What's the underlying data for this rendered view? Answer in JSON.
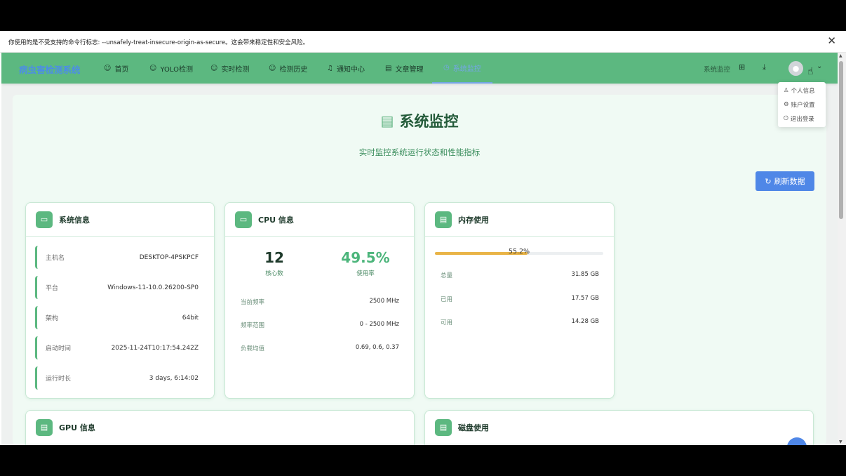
{
  "browser": {
    "warning": "你使用的是不受支持的命令行标志: --unsafely-treat-insecure-origin-as-secure。这会带来稳定性和安全风险。",
    "close_icon": "close-icon"
  },
  "nav": {
    "brand": "病虫害检测系统",
    "items": [
      {
        "label": "首页",
        "icon": "robot-icon"
      },
      {
        "label": "YOLO检测",
        "icon": "robot-icon"
      },
      {
        "label": "实时检测",
        "icon": "robot-icon"
      },
      {
        "label": "检测历史",
        "icon": "robot-icon"
      },
      {
        "label": "通知中心",
        "icon": "bell-icon"
      },
      {
        "label": "文章管理",
        "icon": "document-icon"
      },
      {
        "label": "系统监控",
        "icon": "monitor-icon"
      }
    ],
    "right_label": "系统监控",
    "user_menu": [
      "个人信息",
      "账户设置",
      "退出登录"
    ]
  },
  "page": {
    "title": "系统监控",
    "subtitle": "实时监控系统运行状态和性能指标",
    "refresh_label": "刷新数据"
  },
  "system_info": {
    "title": "系统信息",
    "rows": [
      {
        "key": "主机名",
        "value": "DESKTOP-4PSKPCF"
      },
      {
        "key": "平台",
        "value": "Windows-11-10.0.26200-SP0"
      },
      {
        "key": "架构",
        "value": "64bit"
      },
      {
        "key": "启动时间",
        "value": "2025-11-24T10:17:54.242Z"
      },
      {
        "key": "运行时长",
        "value": "3 days, 6:14:02"
      }
    ]
  },
  "cpu_info": {
    "title": "CPU 信息",
    "cores_value": "12",
    "cores_label": "核心数",
    "usage_value": "49.5%",
    "usage_label": "使用率",
    "rows": [
      {
        "key": "当前频率",
        "value": "2500 MHz"
      },
      {
        "key": "频率范围",
        "value": "0 - 2500 MHz"
      },
      {
        "key": "负载均值",
        "value": "0.69, 0.6, 0.37"
      }
    ]
  },
  "memory": {
    "title": "内存使用",
    "percent_label": "55.2%",
    "percent": 55.2,
    "bar_color": "#e9b447",
    "rows": [
      {
        "key": "总量",
        "value": "31.85 GB"
      },
      {
        "key": "已用",
        "value": "17.57 GB"
      },
      {
        "key": "可用",
        "value": "14.28 GB"
      }
    ]
  },
  "gpu": {
    "title": "GPU 信息"
  },
  "disk": {
    "title": "磁盘使用"
  },
  "colors": {
    "accent": "#5cb880",
    "primary": "#4f87e7"
  }
}
